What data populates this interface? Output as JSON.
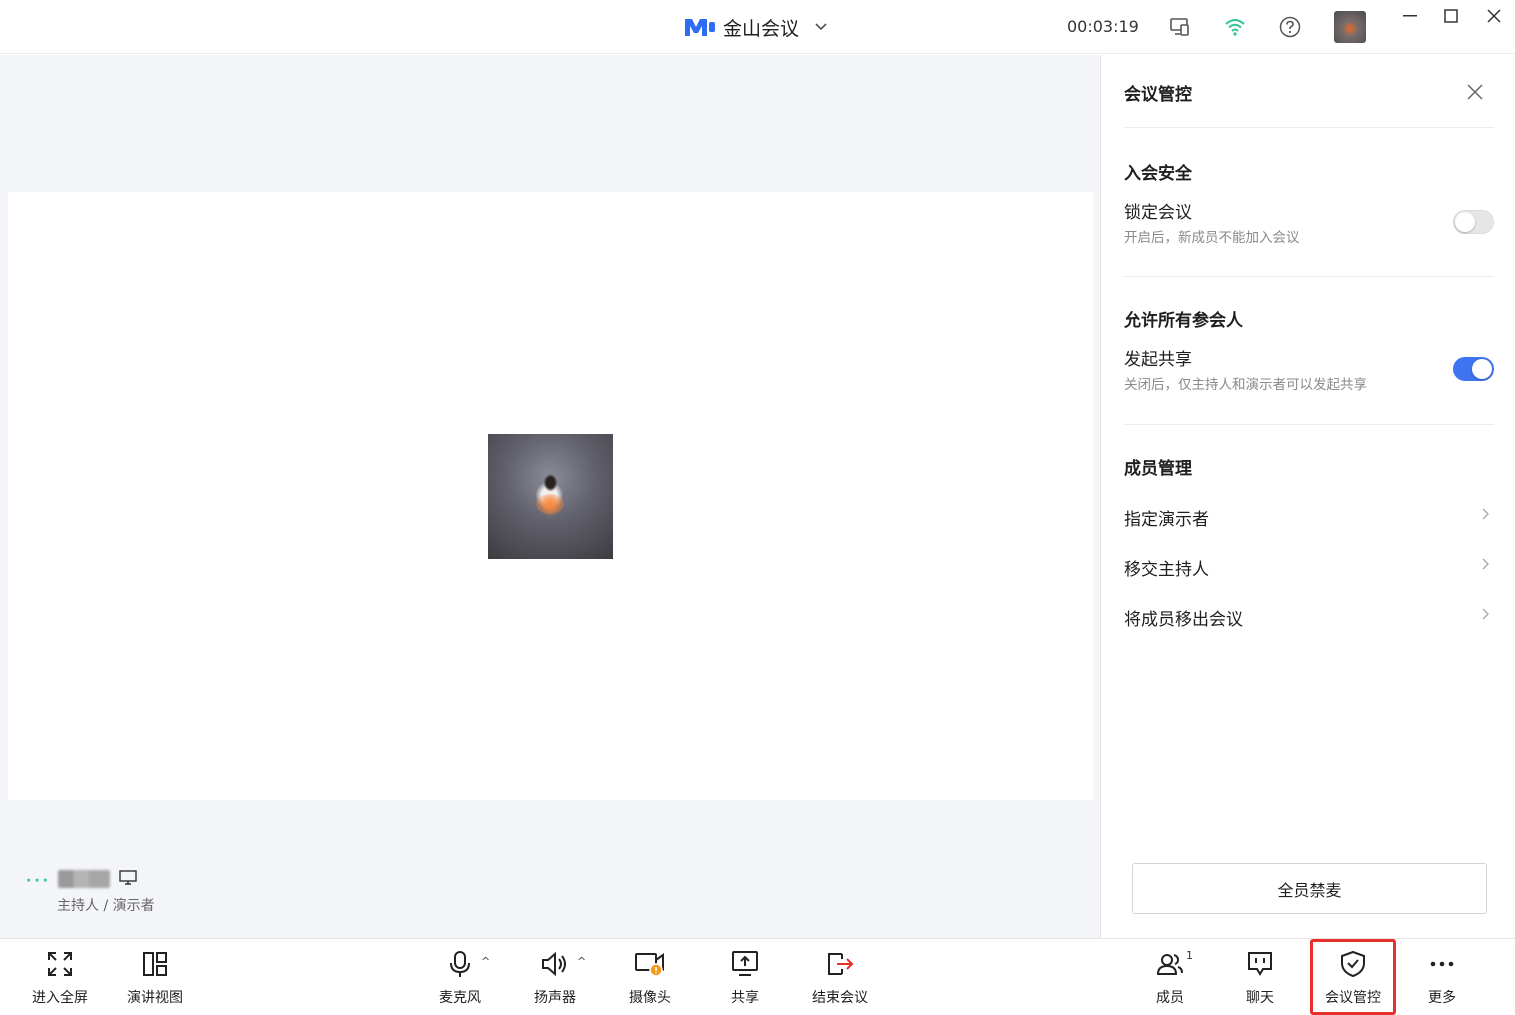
{
  "titlebar": {
    "app_name": "金山会议",
    "timer": "00:03:19",
    "icons": [
      "device-switch-icon",
      "wifi-signal-icon",
      "help-icon",
      "user-avatar",
      "chevron-down-icon"
    ],
    "window_controls": [
      "minimize",
      "maximize",
      "close"
    ]
  },
  "stage": {
    "participant": {
      "speaking_indicator": "···",
      "role": "主持人 / 演示者"
    }
  },
  "panel": {
    "title": "会议管控",
    "sections": {
      "security": {
        "heading": "入会安全",
        "lock_label": "锁定会议",
        "lock_desc": "开启后，新成员不能加入会议",
        "lock_on": false
      },
      "permissions": {
        "heading": "允许所有参会人",
        "share_label": "发起共享",
        "share_desc": "关闭后，仅主持人和演示者可以发起共享",
        "share_on": true
      },
      "members": {
        "heading": "成员管理",
        "items": [
          {
            "label": "指定演示者"
          },
          {
            "label": "移交主持人"
          },
          {
            "label": "将成员移出会议"
          }
        ]
      }
    },
    "mute_all_label": "全员禁麦"
  },
  "toolbar": {
    "fullscreen": "进入全屏",
    "speaker_view": "演讲视图",
    "microphone": "麦克风",
    "speaker": "扬声器",
    "camera": "摄像头",
    "share": "共享",
    "end_meeting": "结束会议",
    "members": "成员",
    "members_count": "1",
    "chat": "聊天",
    "meeting_control": "会议管控",
    "more": "更多"
  },
  "colors": {
    "accent_blue": "#3e74f2",
    "signal_green": "#2bc48a",
    "end_red": "#e5302b",
    "camera_warning": "#f39a1e"
  }
}
